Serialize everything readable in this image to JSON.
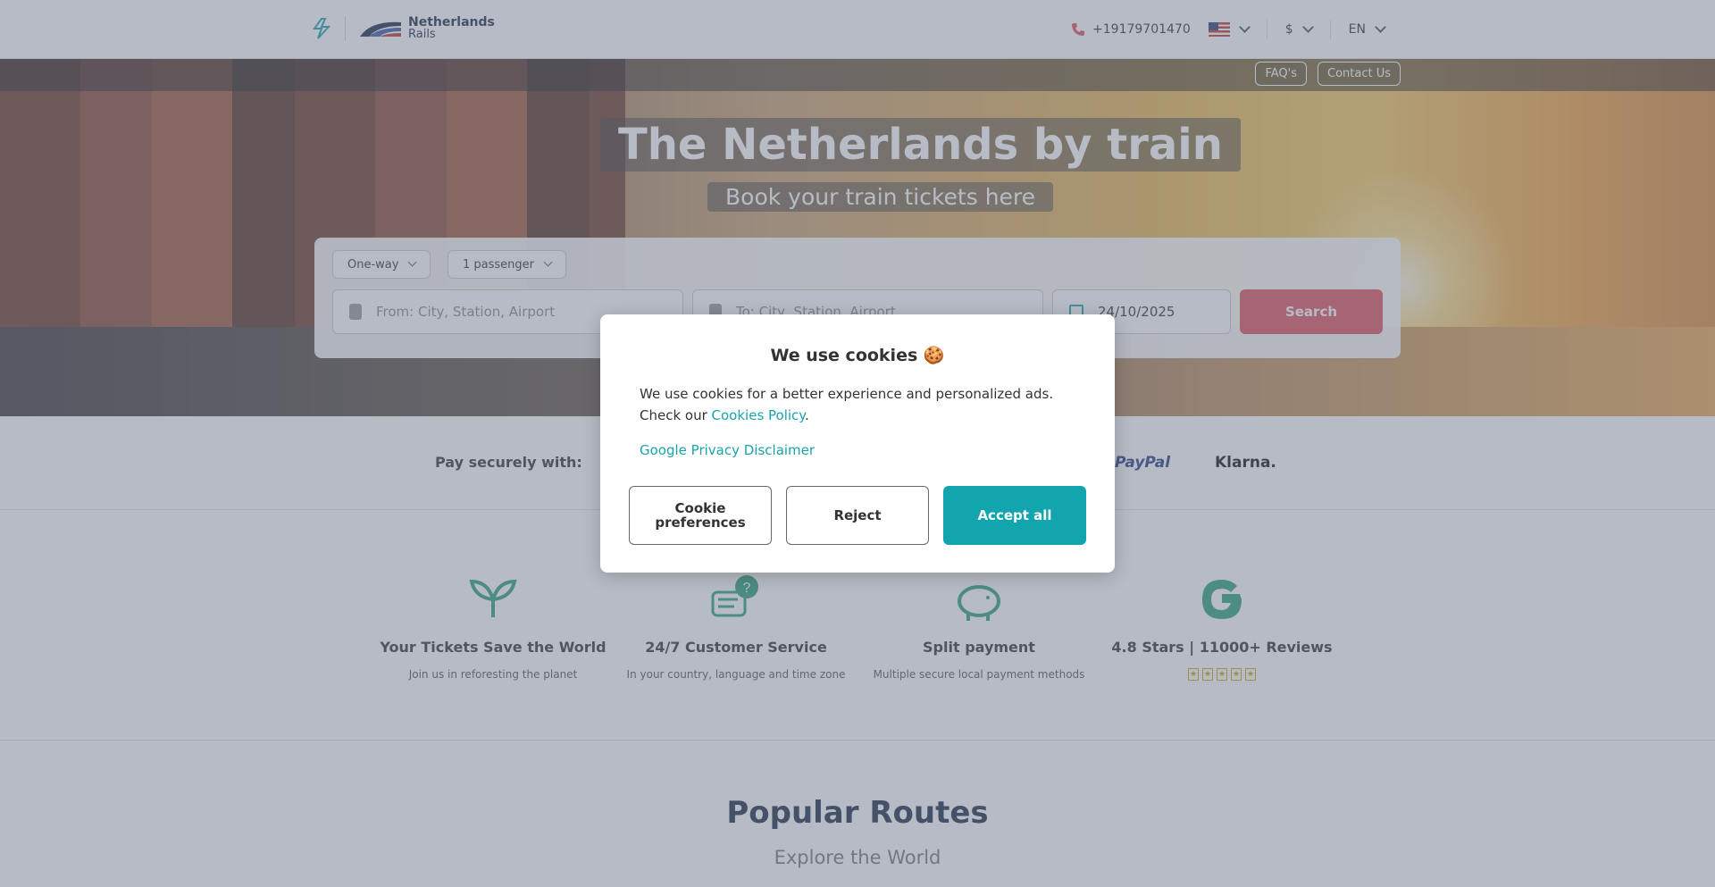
{
  "header": {
    "brand_name": "Netherlands",
    "brand_sub": "Rails",
    "phone": "+19179701470",
    "currency": "$",
    "language": "EN"
  },
  "hero": {
    "faq_link": "FAQ's",
    "contact_link": "Contact Us",
    "title": "The Netherlands by train",
    "subtitle": "Book your train tickets here"
  },
  "search": {
    "trip_type": "One-way",
    "passengers": "1 passenger",
    "from_placeholder": "From: City, Station, Airport",
    "to_placeholder": "To: City, Station, Airport",
    "date": "24/10/2025",
    "search_label": "Search"
  },
  "payments": {
    "label": "Pay securely with:",
    "paypal": "PayPal",
    "klarna": "Klarna."
  },
  "features": [
    {
      "title": "Your Tickets Save the World",
      "desc": "Join us in reforesting the planet",
      "icon": "leaf-icon"
    },
    {
      "title": "24/7 Customer Service",
      "desc": "In your country, language and time zone",
      "icon": "chat-question-icon"
    },
    {
      "title": "Split payment",
      "desc": "Multiple secure local payment methods",
      "icon": "piggy-bank-icon"
    },
    {
      "title": "4.8 Stars | 11000+ Reviews",
      "desc": "",
      "icon": "google-icon"
    }
  ],
  "routes": {
    "title": "Popular Routes",
    "subtitle": "Explore the World"
  },
  "cookie_modal": {
    "title": "We use cookies 🍪",
    "body": "We use cookies for a better experience and personalized ads. Check our ",
    "policy_link": "Cookies Policy",
    "period": ".",
    "disclaimer_link": "Google Privacy Disclaimer",
    "pref_label": "Cookie preferences",
    "reject_label": "Reject",
    "accept_label": "Accept all"
  },
  "colors": {
    "accent": "#12a5ae",
    "search_button": "#e0505c",
    "feature_icon": "#2aa07a",
    "overlay": "rgba(110,120,140,0.5)"
  }
}
